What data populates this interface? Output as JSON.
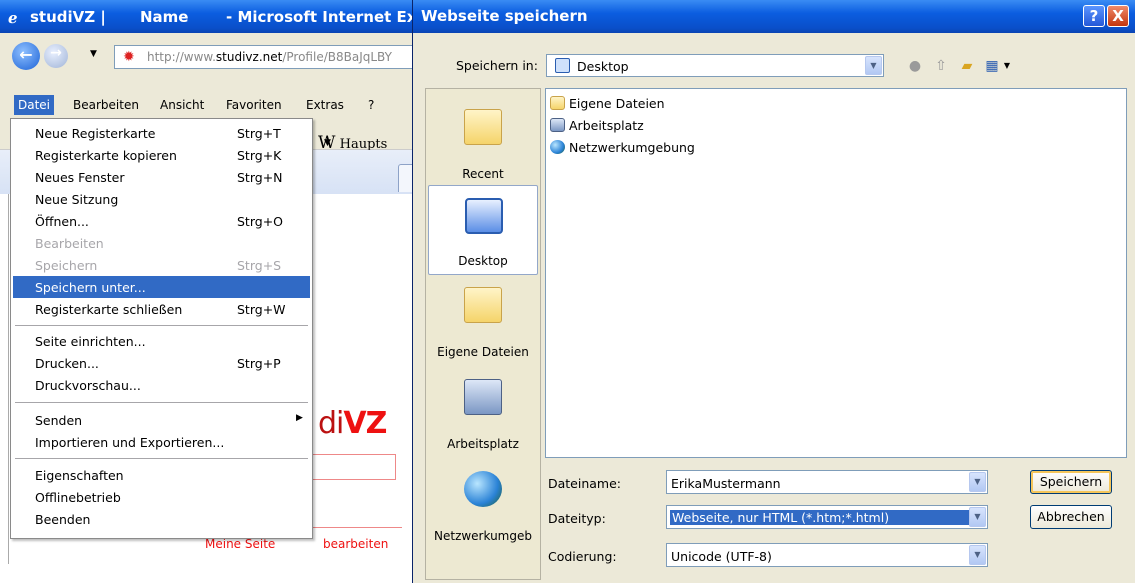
{
  "browser": {
    "title_parts": [
      "studiVZ |",
      "Name",
      "- Microsoft Internet Exp"
    ],
    "address_prefix": "http://www.",
    "address_domain": "studivz.net",
    "address_suffix": "/Profile/B8BaJqLBY",
    "menubar": [
      "Datei",
      "Bearbeiten",
      "Ansicht",
      "Favoriten",
      "Extras",
      "?"
    ],
    "favorites_link": "Haupts",
    "page": {
      "logo_prefix": "di",
      "logo_main": "VZ",
      "link_my_page": "Meine Seite",
      "link_edit": "bearbeiten"
    }
  },
  "file_menu": {
    "groups": [
      [
        {
          "label": "Neue Registerkarte",
          "shortcut": "Strg+T",
          "state": "normal"
        },
        {
          "label": "Registerkarte kopieren",
          "shortcut": "Strg+K",
          "state": "normal"
        },
        {
          "label": "Neues Fenster",
          "shortcut": "Strg+N",
          "state": "normal"
        },
        {
          "label": "Neue Sitzung",
          "shortcut": "",
          "state": "normal"
        },
        {
          "label": "Öffnen...",
          "shortcut": "Strg+O",
          "state": "normal"
        },
        {
          "label": "Bearbeiten",
          "shortcut": "",
          "state": "disabled"
        },
        {
          "label": "Speichern",
          "shortcut": "Strg+S",
          "state": "disabled"
        },
        {
          "label": "Speichern unter...",
          "shortcut": "",
          "state": "selected"
        },
        {
          "label": "Registerkarte schließen",
          "shortcut": "Strg+W",
          "state": "normal"
        }
      ],
      [
        {
          "label": "Seite einrichten...",
          "shortcut": "",
          "state": "normal"
        },
        {
          "label": "Drucken...",
          "shortcut": "Strg+P",
          "state": "normal"
        },
        {
          "label": "Druckvorschau...",
          "shortcut": "",
          "state": "normal"
        }
      ],
      [
        {
          "label": "Senden",
          "shortcut": "",
          "state": "normal",
          "submenu": true
        },
        {
          "label": "Importieren und Exportieren...",
          "shortcut": "",
          "state": "normal"
        }
      ],
      [
        {
          "label": "Eigenschaften",
          "shortcut": "",
          "state": "normal"
        },
        {
          "label": "Offlinebetrieb",
          "shortcut": "",
          "state": "normal"
        },
        {
          "label": "Beenden",
          "shortcut": "",
          "state": "normal"
        }
      ]
    ]
  },
  "dialog": {
    "title": "Webseite speichern",
    "help_symbol": "?",
    "close_symbol": "X",
    "save_in_label": "Speichern in:",
    "save_in_value": "Desktop",
    "places": [
      {
        "label": "Recent",
        "icon": "recent-folder-icon"
      },
      {
        "label": "Desktop",
        "icon": "desktop-icon",
        "selected": true
      },
      {
        "label": "Eigene Dateien",
        "icon": "my-documents-icon"
      },
      {
        "label": "Arbeitsplatz",
        "icon": "my-computer-icon"
      },
      {
        "label": "Netzwerkumgeb",
        "icon": "network-icon"
      }
    ],
    "files": [
      {
        "label": "Eigene Dateien",
        "icon": "my-documents-icon"
      },
      {
        "label": "Arbeitsplatz",
        "icon": "my-computer-icon"
      },
      {
        "label": "Netzwerkumgebung",
        "icon": "network-icon"
      }
    ],
    "filename_label": "Dateiname:",
    "filename_value": "ErikaMustermann",
    "filetype_label": "Dateityp:",
    "filetype_value": "Webseite, nur HTML (*.htm;*.html)",
    "encoding_label": "Codierung:",
    "encoding_value": "Unicode (UTF-8)",
    "save_button": "Speichern",
    "cancel_button": "Abbrechen"
  }
}
